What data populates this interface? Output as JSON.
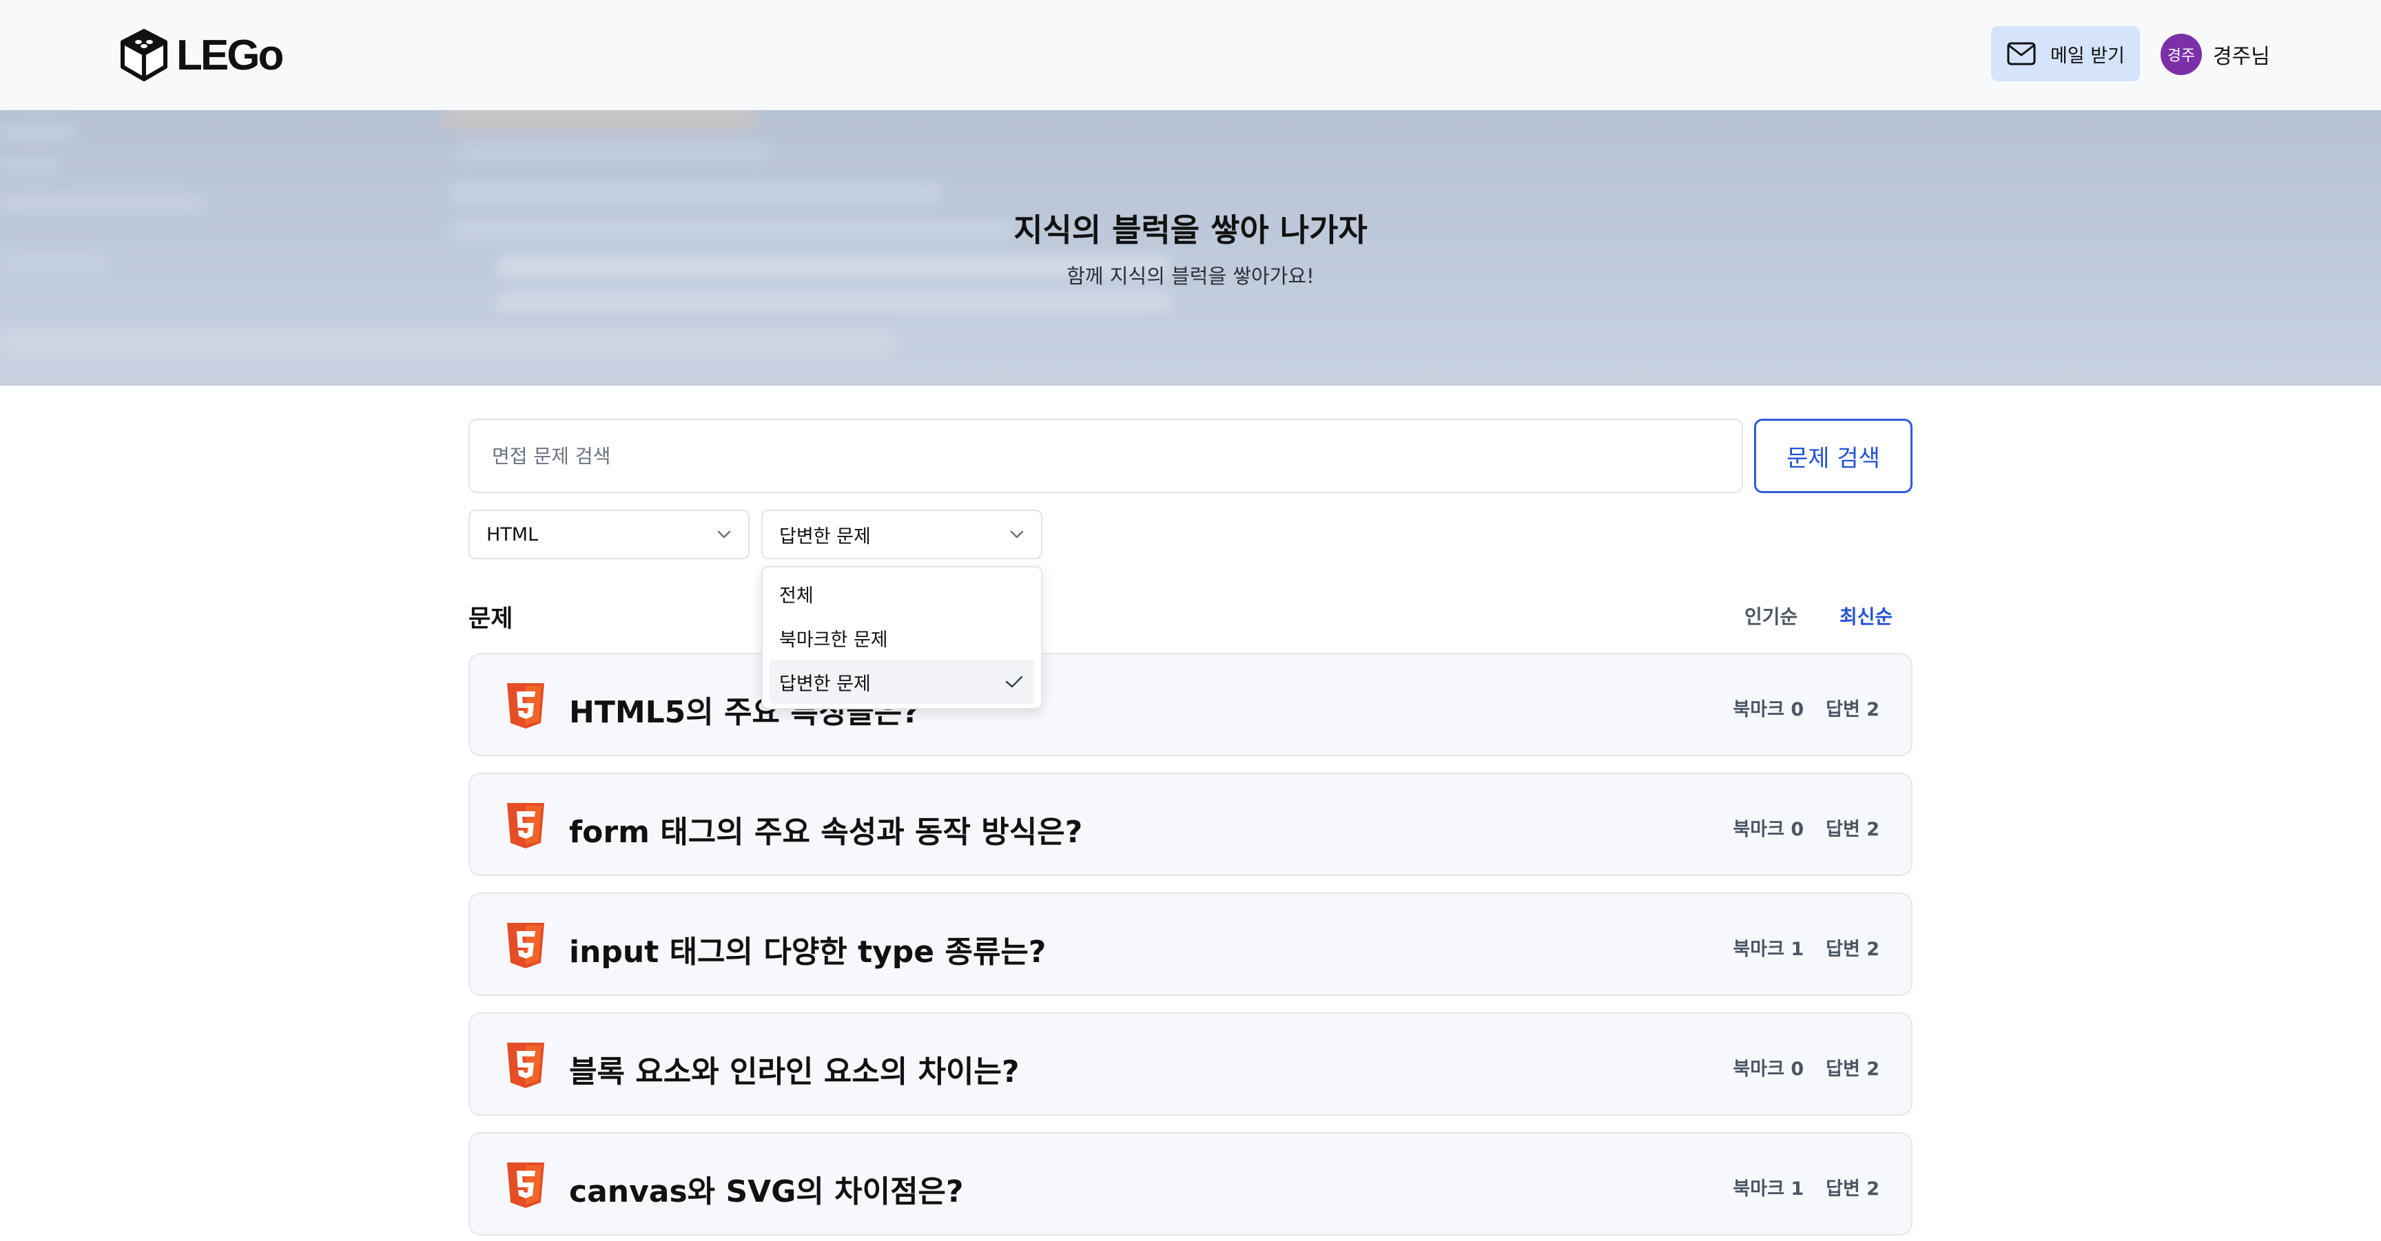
{
  "header": {
    "logo_text": "LEGo",
    "mail_label": "메일 받기",
    "user_avatar": "경주",
    "user_name": "경주님"
  },
  "hero": {
    "title": "지식의 블럭을 쌓아 나가자",
    "subtitle": "함께 지식의 블럭을 쌓아가요!"
  },
  "search": {
    "placeholder": "면접 문제 검색",
    "value": "",
    "button_label": "문제 검색"
  },
  "filters": {
    "category": {
      "value": "HTML"
    },
    "status": {
      "value": "답변한 문제",
      "options": [
        "전체",
        "북마크한 문제",
        "답변한 문제"
      ],
      "selected_index": 2
    }
  },
  "list": {
    "title": "문제",
    "sort_popular": "인기순",
    "sort_latest": "최신순",
    "active_sort": "최신순",
    "questions": [
      {
        "title": "HTML5의 주요 특징들은?",
        "bookmark": "북마크 0",
        "answers": "답변 2"
      },
      {
        "title": "form 태그의 주요 속성과 동작 방식은?",
        "bookmark": "북마크 0",
        "answers": "답변 2"
      },
      {
        "title": "input 태그의 다양한 type 종류는?",
        "bookmark": "북마크 1",
        "answers": "답변 2"
      },
      {
        "title": "블록 요소와 인라인 요소의 차이는?",
        "bookmark": "북마크 0",
        "answers": "답변 2"
      },
      {
        "title": "canvas와 SVG의 차이점은?",
        "bookmark": "북마크 1",
        "answers": "답변 2"
      }
    ]
  },
  "icons": {
    "logo": "lego-block-icon",
    "mail": "mail-icon",
    "chevron": "chevron-down-icon",
    "check": "check-icon",
    "question": "html5-icon"
  },
  "colors": {
    "accent": "#2352d6",
    "mail_button_bg": "#d5e3fb",
    "avatar_bg": "#7b2fa8",
    "html5_orange": "#e44d26"
  }
}
